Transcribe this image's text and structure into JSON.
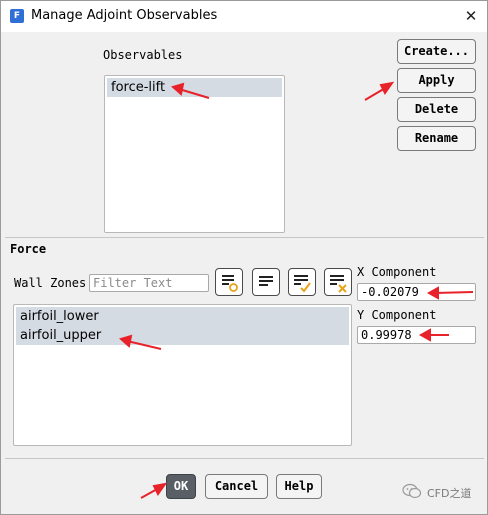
{
  "window": {
    "title": "Manage Adjoint Observables",
    "app_icon_letter": "F"
  },
  "observables": {
    "label": "Observables",
    "items": [
      {
        "label": "force-lift",
        "selected": true
      }
    ]
  },
  "side_buttons": {
    "create": "Create...",
    "apply": "Apply",
    "delete": "Delete",
    "rename": "Rename"
  },
  "force": {
    "section_label": "Force",
    "wall_zones_label": "Wall Zones",
    "filter_placeholder": "Filter Text",
    "zones": [
      {
        "label": "airfoil_lower",
        "selected": true
      },
      {
        "label": "airfoil_upper",
        "selected": true
      }
    ],
    "x_component_label": "X Component",
    "x_component_value": "-0.02079",
    "y_component_label": "Y Component",
    "y_component_value": "0.99978"
  },
  "footer": {
    "ok": "OK",
    "cancel": "Cancel",
    "help": "Help"
  },
  "watermark": {
    "text": "CFD之道"
  },
  "colors": {
    "annotation_arrow": "#e8222a",
    "selection": "#d5dbe3",
    "ok_button": "#5a5f66",
    "checkmark": "#e8a317",
    "clear_x": "#e8a317"
  }
}
